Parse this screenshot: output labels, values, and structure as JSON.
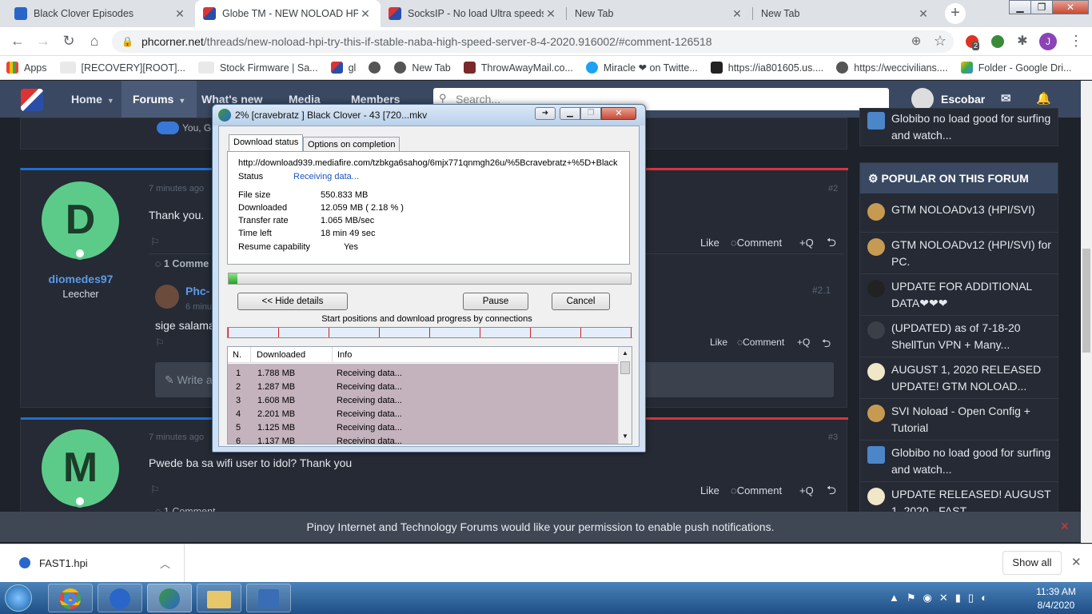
{
  "browser": {
    "tabs": [
      {
        "title": "Black Clover Episodes",
        "active": false
      },
      {
        "title": "Globe TM - NEW NOLOAD HPI",
        "active": true
      },
      {
        "title": "SocksIP - No load Ultra speeds",
        "active": false
      },
      {
        "title": "New Tab",
        "active": false
      },
      {
        "title": "New Tab",
        "active": false
      }
    ],
    "new_tab_label": "+",
    "url_domain": "phcorner.net",
    "url_path": "/threads/new-noload-hpi-try-this-if-stable-naba-high-speed-server-8-4-2020.916002/#comment-126518",
    "extension_badge": "2",
    "profile_initial": "J",
    "bookmarks": [
      "Apps",
      "[RECOVERY][ROOT]...",
      "Stock Firmware | Sa...",
      "gl",
      "",
      "New Tab",
      "ThrowAwayMail.co...",
      "Miracle ❤ on Twitte...",
      "https://ia801605.us....",
      "https://weccivilians....",
      "Folder - Google Dri..."
    ]
  },
  "site": {
    "nav": [
      "Home",
      "Forums",
      "What's new",
      "Media",
      "Members"
    ],
    "search_placeholder": "Search...",
    "username": "Escobar",
    "reaction_text": "You, Gi",
    "posts": [
      {
        "avatar_letter": "D",
        "username": "diomedes97",
        "role": "Leecher",
        "time": "7 minutes ago",
        "post_no": "#2",
        "text": "Thank you.",
        "comments_label": "1 Comme",
        "reply": {
          "user": "Phc-",
          "time": "6 minu",
          "post_no": "#2.1",
          "text": "sige salama"
        },
        "write_placeholder": "Write a"
      },
      {
        "avatar_letter": "M",
        "time": "7 minutes ago",
        "post_no": "#3",
        "text": "Pwede ba sa wifi user to idol? Thank you",
        "comments_label": "1 Comment"
      }
    ],
    "actions": {
      "like": "Like",
      "comment": "Comment",
      "quote": "+Q"
    },
    "sidebar_top_item": "Globibo no load good for surfing and watch...",
    "popular_title": "POPULAR ON THIS FORUM",
    "popular": [
      "GTM NOLOADv13 (HPI/SVI)",
      "GTM NOLOADv12 (HPI/SVI) for PC.",
      "UPDATE FOR ADDITIONAL DATA❤❤❤",
      "(UPDATED) as of 7-18-20 ShellTun VPN + Many...",
      "AUGUST 1, 2020 RELEASED UPDATE! GTM NOLOAD...",
      "SVI Noload - Open Config + Tutorial",
      "Globibo no load good for surfing and watch...",
      "UPDATE RELEASED! AUGUST 1, 2020 - FAST..."
    ],
    "notification": "Pinoy Internet and Technology Forums would like your permission to enable push notifications."
  },
  "idm": {
    "title": "2% [cravebratz ] Black Clover - 43 [720...mkv",
    "tabs": [
      "Download status",
      "Options on completion"
    ],
    "url": "http://download939.mediafire.com/tzbkga6sahog/6mjx771qnmgh26u/%5Bcravebratz+%5D+Black",
    "status_label": "Status",
    "status": "Receiving data...",
    "labels": {
      "file_size": "File size",
      "downloaded": "Downloaded",
      "rate": "Transfer rate",
      "time_left": "Time left",
      "resume": "Resume capability"
    },
    "file_size": "550.833  MB",
    "downloaded": "12.059  MB  ( 2.18 % )",
    "rate": "1.065  MB/sec",
    "time_left": "18 min 49 sec",
    "resume": "Yes",
    "progress_fraction": 0.0218,
    "buttons": {
      "hide": "<< Hide details",
      "pause": "Pause",
      "cancel": "Cancel"
    },
    "connections_label": "Start positions and download progress by connections",
    "table_headers": [
      "N.",
      "Downloaded",
      "Info"
    ],
    "connections": [
      {
        "n": "1",
        "dl": "1.788  MB",
        "info": "Receiving data..."
      },
      {
        "n": "2",
        "dl": "1.287  MB",
        "info": "Receiving data..."
      },
      {
        "n": "3",
        "dl": "1.608  MB",
        "info": "Receiving data..."
      },
      {
        "n": "4",
        "dl": "2.201  MB",
        "info": "Receiving data..."
      },
      {
        "n": "5",
        "dl": "1.125  MB",
        "info": "Receiving data..."
      },
      {
        "n": "6",
        "dl": "1.137  MB",
        "info": "Receiving data..."
      }
    ]
  },
  "downloads_bar": {
    "file": "FAST1.hpi",
    "show_all": "Show all"
  },
  "taskbar": {
    "time": "11:39 AM",
    "date": "8/4/2020"
  },
  "colors": {
    "site_header": "#3a4961",
    "accent_blue": "#1e6fd0",
    "accent_red": "#d9343f",
    "avatar_green": "#5ccb8a",
    "link_blue": "#5a9bea"
  }
}
